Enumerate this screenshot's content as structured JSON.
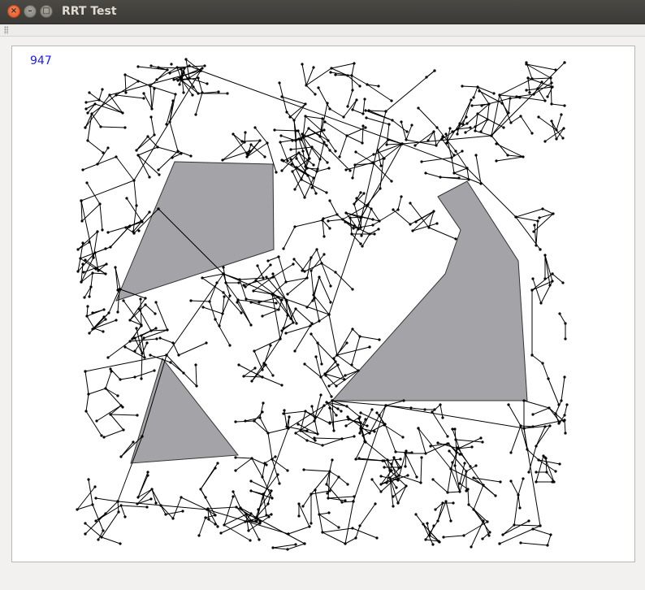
{
  "window": {
    "title": "RRT Test",
    "close_label": "×",
    "minimize_label": "–",
    "maximize_label": "□"
  },
  "canvas": {
    "iteration_count": "947"
  },
  "colors": {
    "obstacle_fill": "#a4a3a7",
    "tree_edge": "#000000",
    "counter_text": "#1a1aff"
  },
  "icons": {
    "close": "close-icon",
    "minimize": "minimize-icon",
    "maximize": "maximize-icon",
    "toolbar_grip": "grip-icon"
  }
}
